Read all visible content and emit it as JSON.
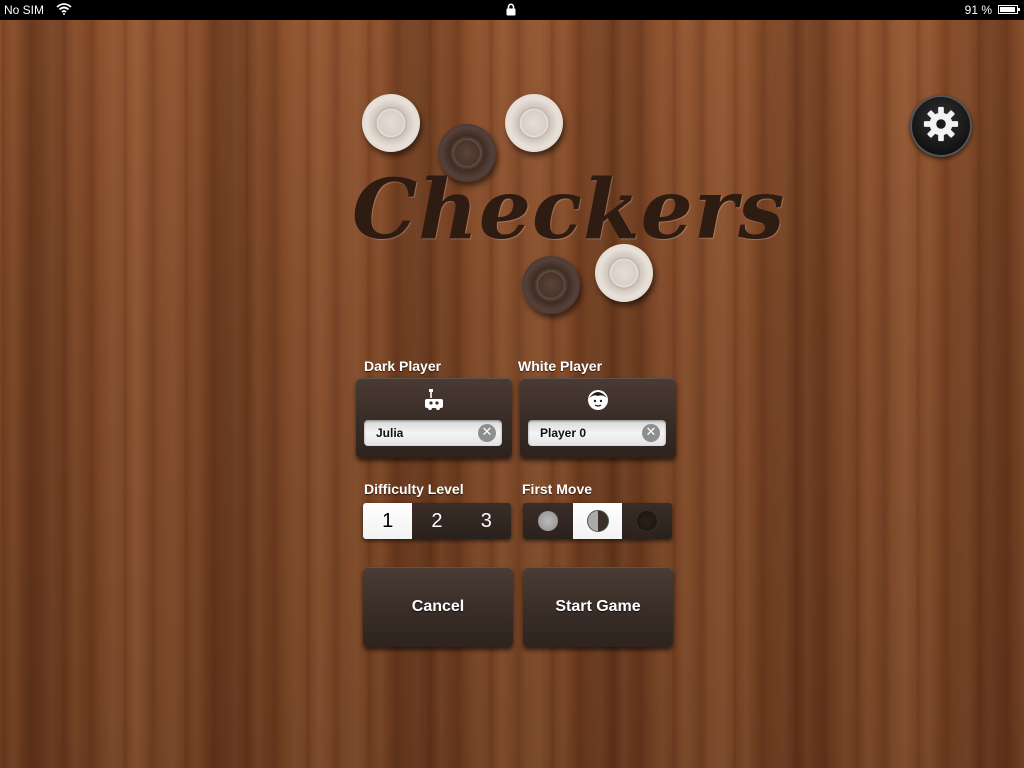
{
  "status_bar": {
    "carrier": "No SIM",
    "battery_percent": "91 %",
    "battery_level": 0.91
  },
  "title": "Checkers",
  "settings": {
    "icon": "gear-icon"
  },
  "dark_player": {
    "label": "Dark Player",
    "icon": "robot-icon",
    "name": "Julia"
  },
  "white_player": {
    "label": "White Player",
    "icon": "person-icon",
    "name": "Player 0"
  },
  "difficulty": {
    "label": "Difficulty Level",
    "options": [
      "1",
      "2",
      "3"
    ],
    "selected": "1"
  },
  "first_move": {
    "label": "First Move",
    "options": [
      "light",
      "random",
      "dark"
    ],
    "selected": "random"
  },
  "buttons": {
    "cancel": "Cancel",
    "start": "Start Game"
  },
  "colors": {
    "wood": "#7c4626",
    "panel": "#3a2d27",
    "title_ink": "#2e1b12",
    "light_piece": "#e6ddd4",
    "dark_piece": "#4a352b"
  }
}
